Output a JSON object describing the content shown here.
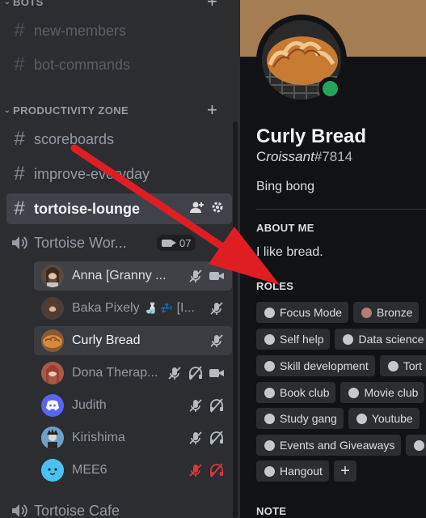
{
  "sidebar": {
    "categories": {
      "bots": "BOTS",
      "productivity": "PRODUCTIVITY ZONE"
    },
    "channels": [
      {
        "label": "new-members"
      },
      {
        "label": "bot-commands"
      },
      {
        "label": "scoreboards"
      },
      {
        "label": "improve-everyday"
      },
      {
        "label": "tortoise-lounge"
      }
    ],
    "voice_channel": {
      "label": "Tortoise Wor...",
      "cam_count": "07"
    },
    "users": [
      {
        "name": "Anna [Granny ..."
      },
      {
        "name": "Baka Pixely",
        "extra": "[I..."
      },
      {
        "name": "Curly Bread"
      },
      {
        "name": "Dona Therap..."
      },
      {
        "name": "Judith"
      },
      {
        "name": "Kirishima"
      },
      {
        "name": "MEE6"
      }
    ],
    "next_voice": "Tortoise Cafe"
  },
  "profile": {
    "display_name": "Curly Bread",
    "username_prefix": "C",
    "username_italic": "roissant",
    "discriminator": "#7814",
    "bio": "Bing bong",
    "about_title": "ABOUT ME",
    "about_text": "I like bread.",
    "roles_title": "ROLES",
    "roles": [
      "Focus Mode",
      "Bronze",
      "Self help",
      "Data science",
      "Skill development",
      "Tort",
      "Book club",
      "Movie club",
      "Study gang",
      "Youtube",
      "Events and Giveaways",
      "Hangout"
    ],
    "note_title": "NOTE",
    "status_color": "#23a55a"
  },
  "annotation": {
    "arrow_color": "#e11d24"
  }
}
